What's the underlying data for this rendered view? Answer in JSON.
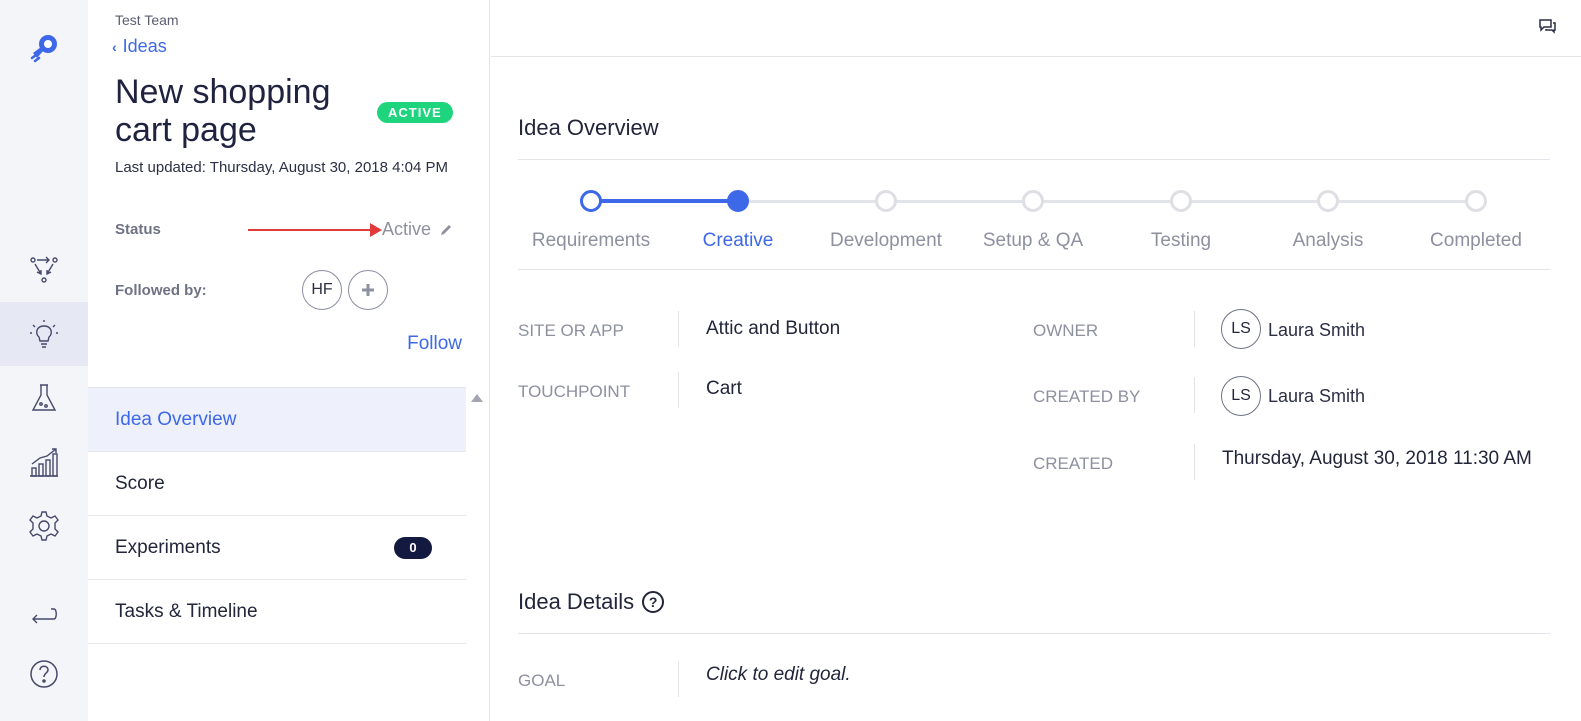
{
  "rail": {
    "icons": [
      "rocket-logo-icon",
      "flow-icon",
      "lightbulb-icon",
      "flask-icon",
      "chart-icon",
      "gear-icon",
      "return-icon",
      "help-icon"
    ],
    "active": "lightbulb-icon",
    "accent": "#3d68e8"
  },
  "panel": {
    "team": "Test Team",
    "back_label": "Ideas",
    "title": "New shopping cart page",
    "badge": "ACTIVE",
    "last_updated": "Last updated: Thursday, August 30, 2018 4:04 PM",
    "status_label": "Status",
    "status_value": "Active",
    "followed_label": "Followed by:",
    "followers": [
      "HF"
    ],
    "follow_label": "Follow",
    "nav": [
      {
        "label": "Idea Overview",
        "active": true
      },
      {
        "label": "Score"
      },
      {
        "label": "Experiments",
        "count": "0"
      },
      {
        "label": "Tasks & Timeline"
      }
    ]
  },
  "main": {
    "overview_title": "Idea Overview",
    "steps": [
      "Requirements",
      "Creative",
      "Development",
      "Setup & QA",
      "Testing",
      "Analysis",
      "Completed"
    ],
    "current_step": "Creative",
    "fields": {
      "site_label": "SITE OR APP",
      "site_value": "Attic and Button",
      "touchpoint_label": "TOUCHPOINT",
      "touchpoint_value": "Cart",
      "owner_label": "OWNER",
      "owner_initials": "LS",
      "owner_name": "Laura Smith",
      "created_by_label": "CREATED BY",
      "created_by_initials": "LS",
      "created_by_name": "Laura Smith",
      "created_label": "CREATED",
      "created_value": "Thursday, August 30, 2018 11:30 AM"
    },
    "details_title": "Idea Details",
    "help_glyph": "?",
    "goal_label": "GOAL",
    "goal_value": "Click to edit goal."
  }
}
